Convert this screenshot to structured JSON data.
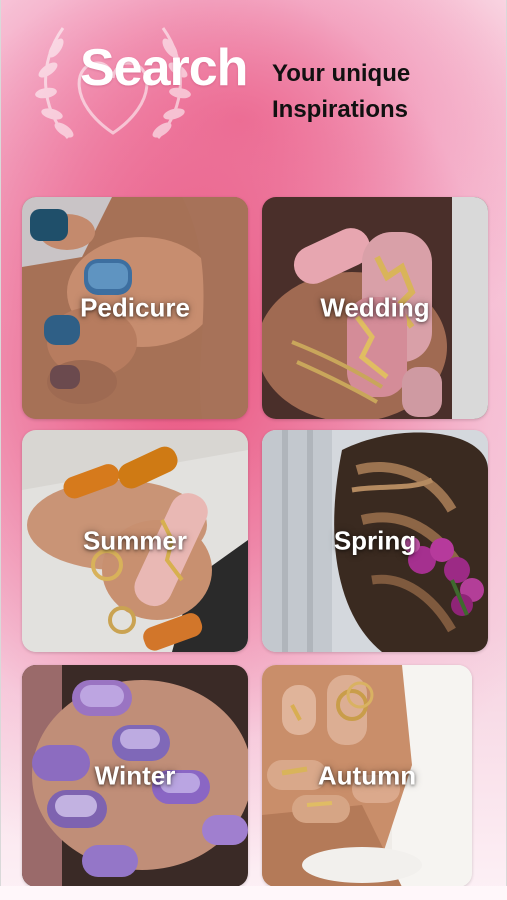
{
  "header": {
    "title": "Search",
    "subtitle_line1": "Your unique",
    "subtitle_line2": "Inspirations",
    "emblem_icon": "laurel-heart-icon"
  },
  "categories": [
    {
      "label": "Pedicure",
      "photo": "pedicure-glitter-toenails"
    },
    {
      "label": "Wedding",
      "photo": "pink-gold-foil-nails"
    },
    {
      "label": "Summer",
      "photo": "orange-gold-leaf-nails"
    },
    {
      "label": "Spring",
      "photo": "braided-hair-flowers"
    },
    {
      "label": "Winter",
      "photo": "chrome-lilac-nails"
    },
    {
      "label": "Autumn",
      "photo": "nude-gold-foil-nails"
    }
  ],
  "colors": {
    "accent_pink": "#e84a78",
    "label_text": "#ffffff",
    "subtitle_text": "#111111"
  }
}
